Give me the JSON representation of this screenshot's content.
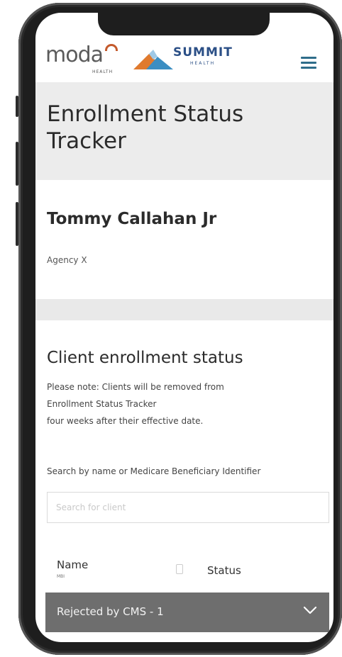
{
  "header": {
    "moda_logo": "moda",
    "moda_sub": "HEALTH",
    "summit_logo": "SUMMIT",
    "summit_sub": "HEALTH",
    "menu_icon": "hamburger-menu-icon"
  },
  "page": {
    "title": "Enrollment Status Tracker"
  },
  "user": {
    "name": "Tommy Callahan Jr",
    "agency": "Agency X"
  },
  "status_section": {
    "title": "Client enrollment status",
    "note_lines": [
      "Please note: Clients will be removed from",
      "Enrollment Status Tracker",
      "four weeks after their effective date."
    ],
    "search_label": "Search by name or Medicare Beneficiary Identifier",
    "search_placeholder": "Search for client",
    "search_value": ""
  },
  "table": {
    "col_name": "Name",
    "col_name_sub": "MBI",
    "col_status": "Status",
    "groups": [
      {
        "label": "Rejected by CMS - 1",
        "expanded": false
      }
    ]
  },
  "colors": {
    "title_band": "#ececec",
    "group_bar": "#6e6e6e",
    "moda_accent": "#c45a2c",
    "summit_blue": "#2b4f86"
  }
}
